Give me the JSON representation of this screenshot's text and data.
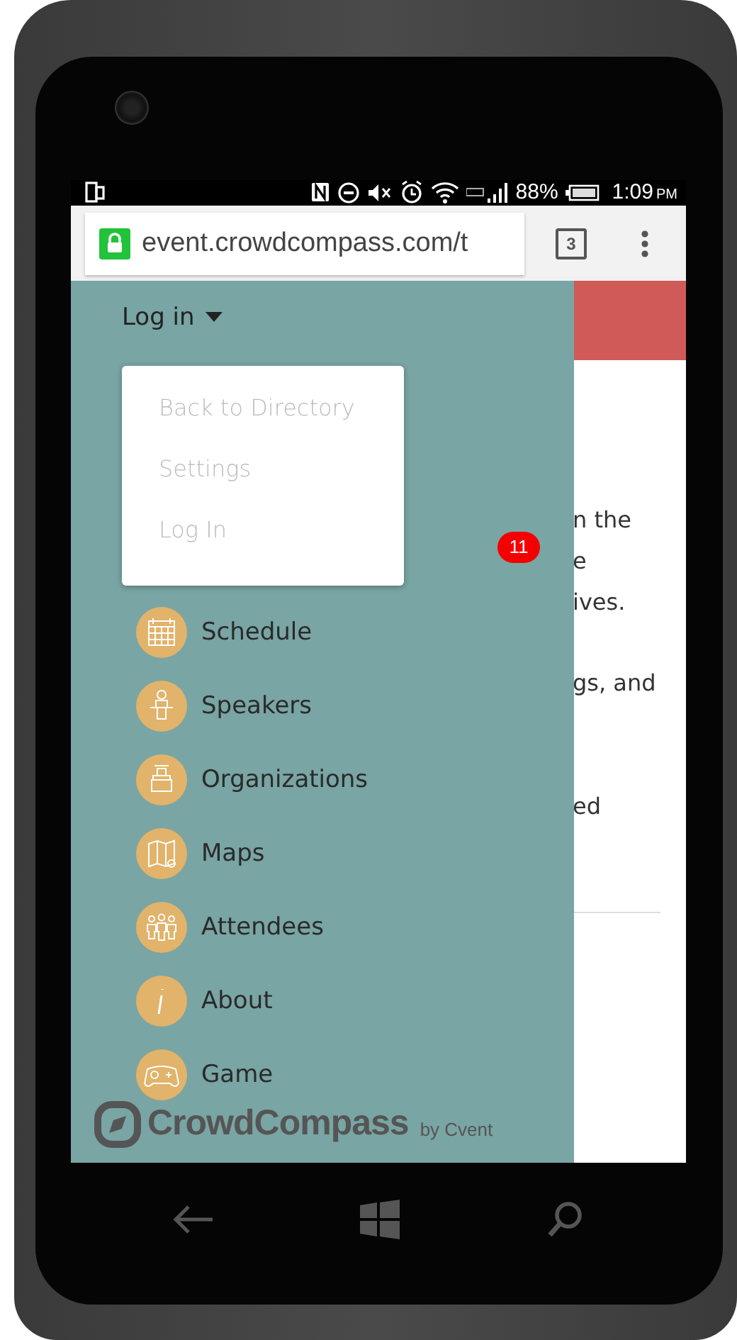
{
  "status_bar": {
    "battery": "88%",
    "time": "1:09",
    "period": "PM"
  },
  "browser": {
    "url": "event.crowdcompass.com/t",
    "tab_count": "3"
  },
  "account_menu": {
    "label": "Log in",
    "expanded": true,
    "items": [
      "Back to Directory",
      "Settings",
      "Log In"
    ]
  },
  "badge": "11",
  "nav_items": [
    {
      "label": "Schedule"
    },
    {
      "label": "Speakers"
    },
    {
      "label": "Organizations"
    },
    {
      "label": "Maps"
    },
    {
      "label": "Attendees"
    },
    {
      "label": "About"
    },
    {
      "label": "Game"
    }
  ],
  "page_text_fragments": [
    "n the",
    "e",
    "ives.",
    "gs, and",
    "ed"
  ],
  "logo": {
    "name": "CrowdCompass",
    "tagline": "by Cvent"
  }
}
